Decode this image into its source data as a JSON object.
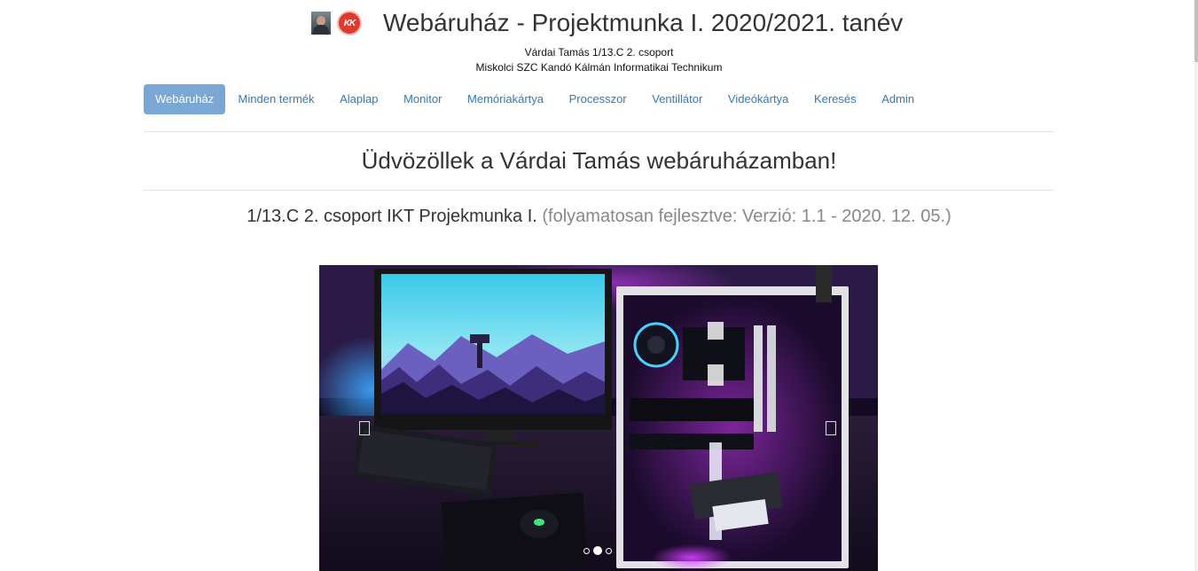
{
  "header": {
    "title": "Webáruház - Projektmunka I. 2020/2021. tanév",
    "logo_text": "KK",
    "subtitle_line1": "Várdai Tamás 1/13.C 2. csoport",
    "subtitle_line2": "Miskolci SZC Kandó Kálmán Informatikai Technikum"
  },
  "nav": {
    "items": [
      {
        "label": "Webáruház",
        "active": true
      },
      {
        "label": "Minden termék"
      },
      {
        "label": "Alaplap"
      },
      {
        "label": "Monitor"
      },
      {
        "label": "Memóriakártya"
      },
      {
        "label": "Processzor"
      },
      {
        "label": "Ventillátor"
      },
      {
        "label": "Videókártya"
      },
      {
        "label": "Keresés"
      },
      {
        "label": "Admin"
      }
    ]
  },
  "main": {
    "welcome": "Üdvözöllek a Várdai Tamás webáruházamban!",
    "info_main": "1/13.C 2. csoport IKT Projekmunka I.",
    "info_muted": "(folyamatosan fejlesztve: Verzió: 1.1 - 2020. 12. 05.)"
  },
  "carousel": {
    "slide_count": 3,
    "active_index": 1,
    "prev_icon": "chevron-left-icon",
    "next_icon": "chevron-right-icon"
  },
  "colors": {
    "nav_active_bg": "#7ba7d4",
    "link": "#337ab7",
    "muted": "#888888"
  }
}
